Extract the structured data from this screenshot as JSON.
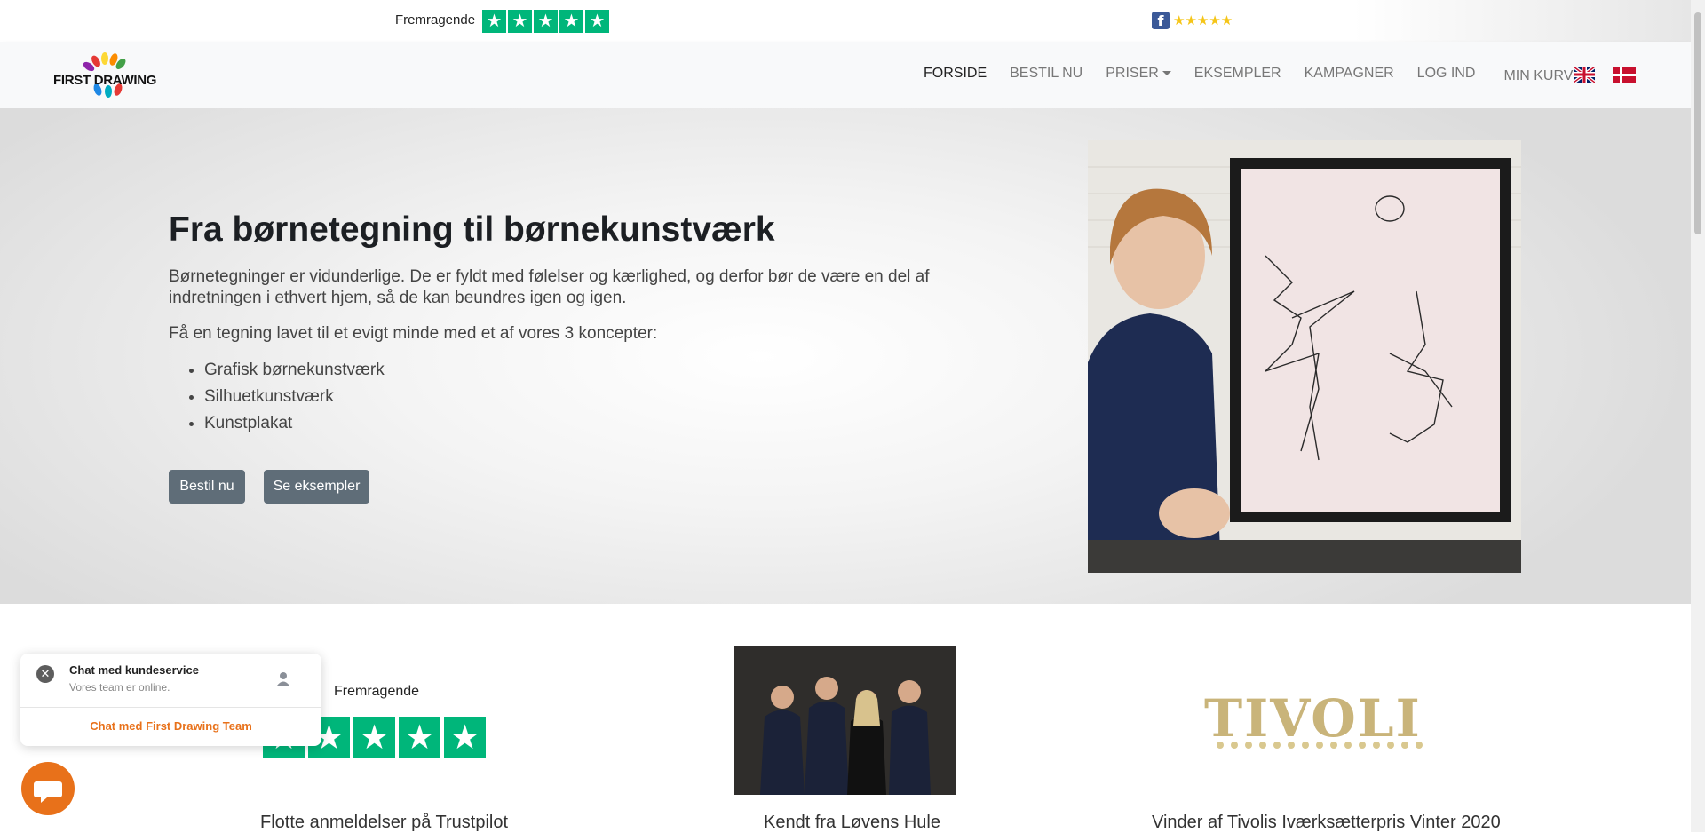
{
  "topbar": {
    "trustpilot_label": "Fremragende",
    "trustpilot_stars": 5,
    "facebook_stars": "★★★★★"
  },
  "nav": {
    "logo_text": "FIRST DRAWING",
    "items": [
      {
        "label": "FORSIDE"
      },
      {
        "label": "BESTIL NU"
      },
      {
        "label": "PRISER"
      },
      {
        "label": "EKSEMPLER"
      },
      {
        "label": "KAMPAGNER"
      },
      {
        "label": "LOG IND"
      },
      {
        "label": "MIN KURV"
      }
    ]
  },
  "hero": {
    "title": "Fra børnetegning til børnekunstværk",
    "paragraph1": "Børnetegninger er vidunderlige. De er fyldt med følelser og kærlighed, og derfor bør de være en del af indretningen i ethvert hjem, så de kan beundres igen og igen.",
    "paragraph2": "Få en tegning lavet til et evigt minde med et af vores 3 koncepter:",
    "concepts": [
      "Grafisk børnekunstværk",
      "Silhuetkunstværk",
      "Kunstplakat"
    ],
    "order_button": "Bestil nu",
    "examples_button": "Se eksempler"
  },
  "features": {
    "trustpilot_label": "Fremragende",
    "trustpilot_caption": "Flotte anmeldelser på Trustpilot",
    "lovens_caption": "Kendt fra Løvens Hule",
    "tivoli_logo": "TIVOLI",
    "tivoli_caption": "Vinder af Tivolis Iværksætterpris Vinter 2020"
  },
  "chat": {
    "title": "Chat med kundeservice",
    "subtitle": "Vores team er online.",
    "link": "Chat med First Drawing Team"
  },
  "colors": {
    "trustpilot_green": "#00b67a",
    "chat_orange": "#e8711a",
    "button_gray": "#5f6d78"
  }
}
